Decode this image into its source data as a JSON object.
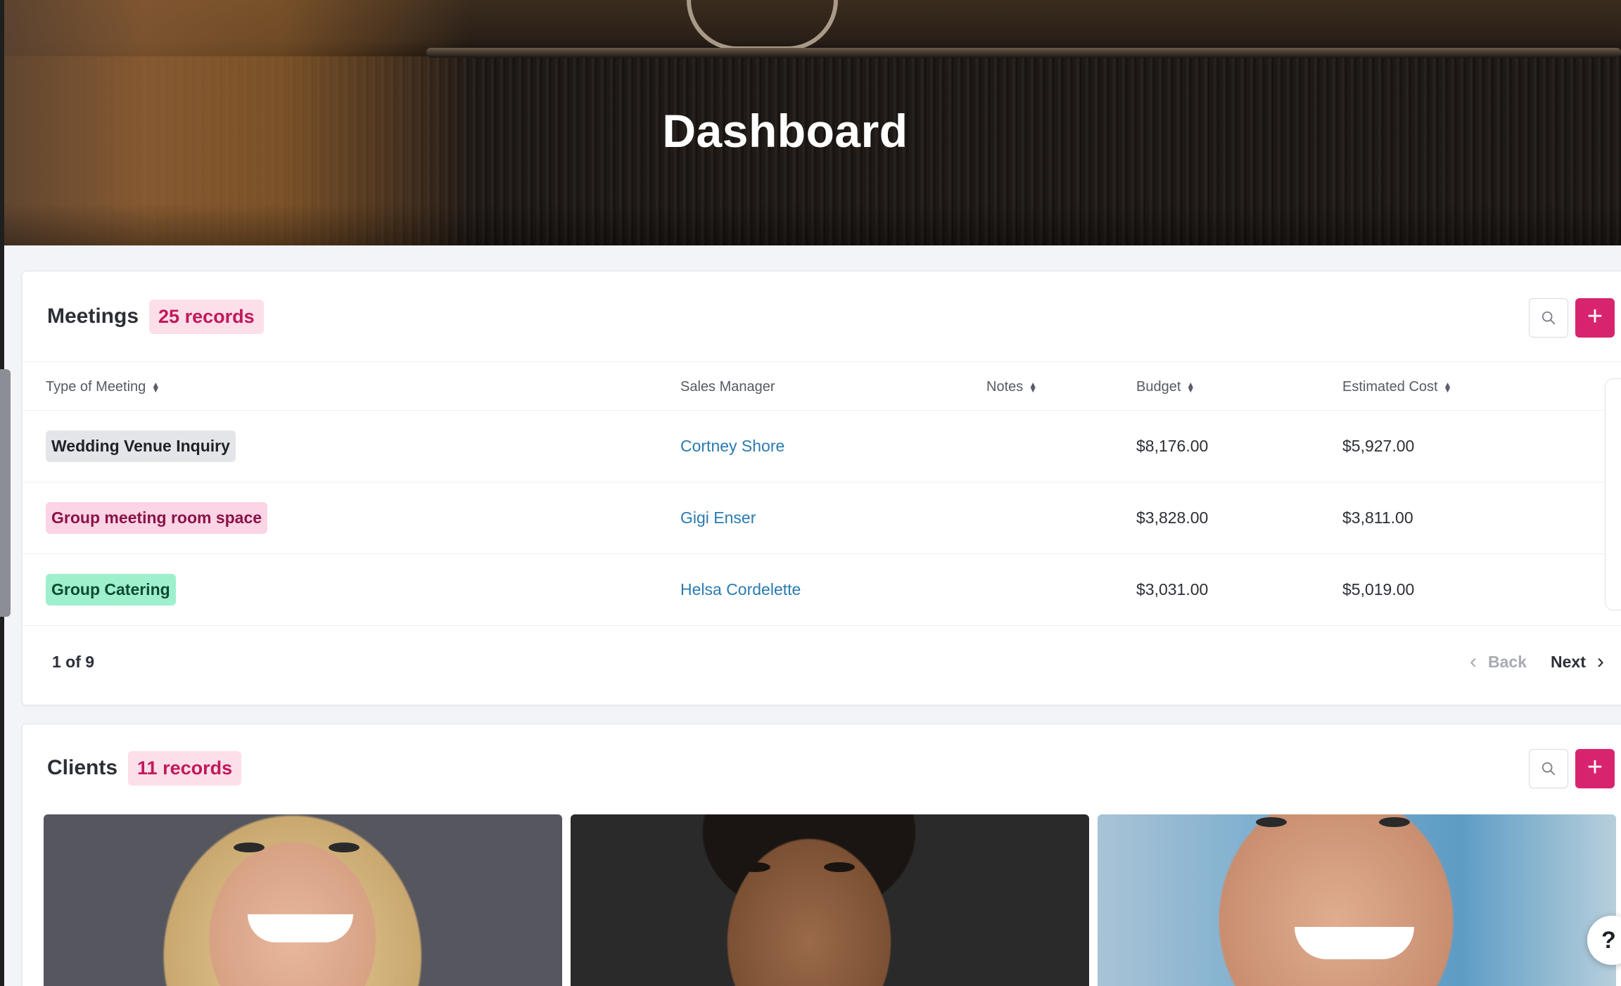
{
  "hero": {
    "title": "Dashboard"
  },
  "meetings": {
    "title": "Meetings",
    "count_badge": "25 records",
    "columns": [
      {
        "label": "Type of Meeting",
        "sortable": true
      },
      {
        "label": "Sales Manager",
        "sortable": false
      },
      {
        "label": "Notes",
        "sortable": true
      },
      {
        "label": "Budget",
        "sortable": true
      },
      {
        "label": "Estimated Cost",
        "sortable": true
      }
    ],
    "rows": [
      {
        "type": "Wedding Venue Inquiry",
        "type_color": "gray",
        "manager": "Cortney Shore",
        "notes": "",
        "budget": "$8,176.00",
        "estimated_cost": "$5,927.00"
      },
      {
        "type": "Group meeting room space",
        "type_color": "pink",
        "manager": "Gigi Enser",
        "notes": "",
        "budget": "$3,828.00",
        "estimated_cost": "$3,811.00"
      },
      {
        "type": "Group Catering",
        "type_color": "green",
        "manager": "Helsa Cordelette",
        "notes": "",
        "budget": "$3,031.00",
        "estimated_cost": "$5,019.00"
      }
    ],
    "pagination": {
      "page_text": "1 of 9",
      "back_label": "Back",
      "next_label": "Next"
    }
  },
  "clients": {
    "title": "Clients",
    "count_badge": "11 records"
  },
  "icons": {
    "search": "search-icon",
    "add": "plus-icon",
    "sort": "sort-icon",
    "back": "chevron-left-icon",
    "next": "chevron-right-icon",
    "help": "help-icon"
  },
  "colors": {
    "accent": "#d8246f",
    "badge_bg": "#fcdfe9",
    "link": "#2a7ab0"
  },
  "help": {
    "label": "?"
  }
}
